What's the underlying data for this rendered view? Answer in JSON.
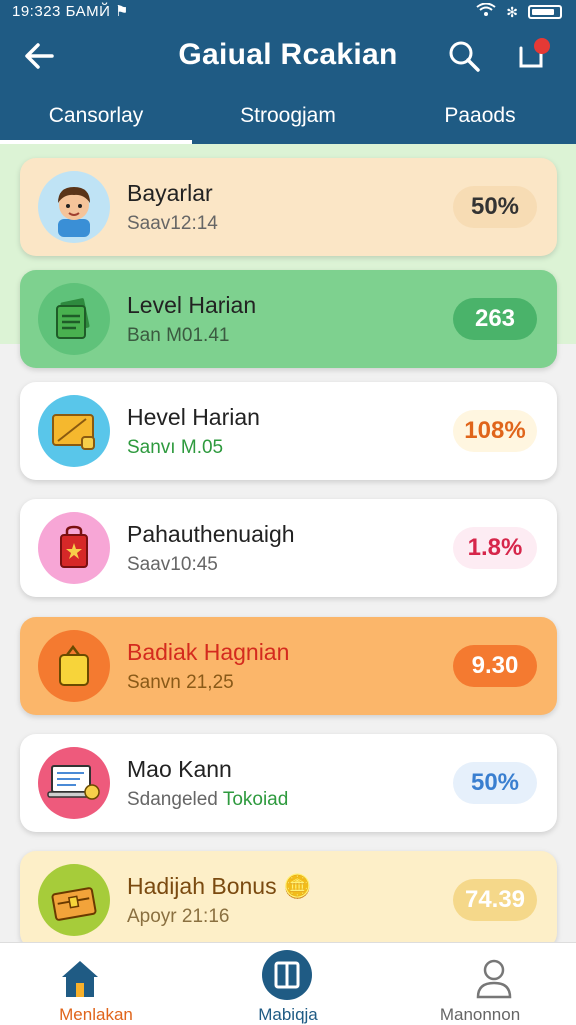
{
  "status_bar": {
    "time": "19:323",
    "carrier": "БАМЙ"
  },
  "header": {
    "title": "Gaiual Rcakian"
  },
  "tabs": [
    {
      "label": "Cansorlay",
      "active": true
    },
    {
      "label": "Stroogjam",
      "active": false
    },
    {
      "label": "Paaods",
      "active": false
    }
  ],
  "cards": [
    {
      "title": "Bayarlar",
      "subtitle": "Saav12:14",
      "value": "50%",
      "icon": "boy-avatar-icon"
    },
    {
      "title": "Level Harian",
      "subtitle": "Ban M01.41",
      "value": "263",
      "icon": "cash-stack-icon"
    },
    {
      "title": "Hevel Harian",
      "subtitle": "Sanvı M.05",
      "value": "108%",
      "icon": "tablet-device-icon"
    },
    {
      "title": "Pahauthenuaigh",
      "subtitle": "Saav10:45",
      "value": "1.8%",
      "icon": "red-bag-icon"
    },
    {
      "title": "Badiak Hagnian",
      "subtitle": "Sanvn 21,25",
      "value": "9.30",
      "icon": "gold-bag-icon"
    },
    {
      "title": "Mao Kann",
      "subtitle": "Sdangeled",
      "subtitle_highlight": "Tokoiad",
      "value": "50%",
      "icon": "laptop-chat-icon"
    },
    {
      "title": "Hadijah Bonus",
      "subtitle": "Apoyr 21:16",
      "value": "74.39",
      "icon": "treasure-chest-icon"
    }
  ],
  "bottom_nav": [
    {
      "label": "Menlakan",
      "icon": "home-icon",
      "active": true
    },
    {
      "label": "Mabiqja",
      "icon": "book-icon",
      "active": false
    },
    {
      "label": "Manonnon",
      "icon": "profile-icon",
      "active": false
    }
  ],
  "colors": {
    "header": "#1f5b84",
    "green_accent": "#4ab36a",
    "orange_accent": "#f47a30",
    "nav_active": "#e0651b",
    "nav_center": "#1f5b84"
  }
}
